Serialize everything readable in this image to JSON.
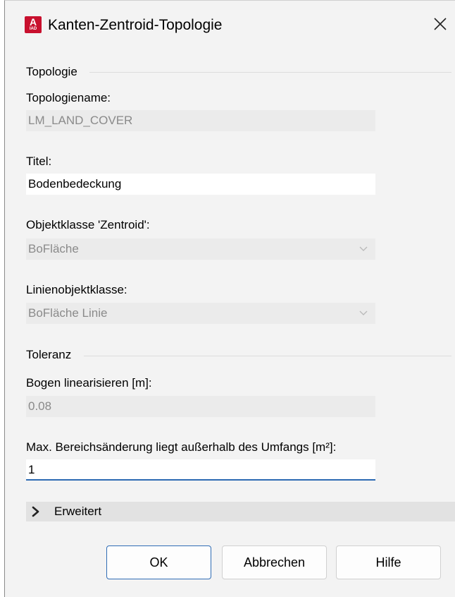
{
  "window": {
    "title": "Kanten-Zentroid-Topologie",
    "icon_letter": "A",
    "icon_sub": "IAD",
    "icon_color": "#c8102e"
  },
  "topology_section": {
    "heading": "Topologie",
    "name_label": "Topologiename:",
    "name_value": "LM_LAND_COVER",
    "title_label": "Titel:",
    "title_value": "Bodenbedeckung",
    "centroid_class_label": "Objektklasse 'Zentroid':",
    "centroid_class_value": "BoFläche",
    "line_class_label": "Linienobjektklasse:",
    "line_class_value": "BoFläche Linie"
  },
  "tolerance_section": {
    "heading": "Toleranz",
    "arc_label": "Bogen linearisieren [m]:",
    "arc_value": "0.08",
    "area_change_label": "Max. Bereichsänderung liegt außerhalb des Umfangs [m²]:",
    "area_change_value": "1"
  },
  "advanced": {
    "label": "Erweitert",
    "expanded": false
  },
  "buttons": {
    "ok": "OK",
    "cancel": "Abbrechen",
    "help": "Hilfe"
  },
  "colors": {
    "focus_accent": "#2d6ab3",
    "default_button_border": "#2f6cb5"
  }
}
